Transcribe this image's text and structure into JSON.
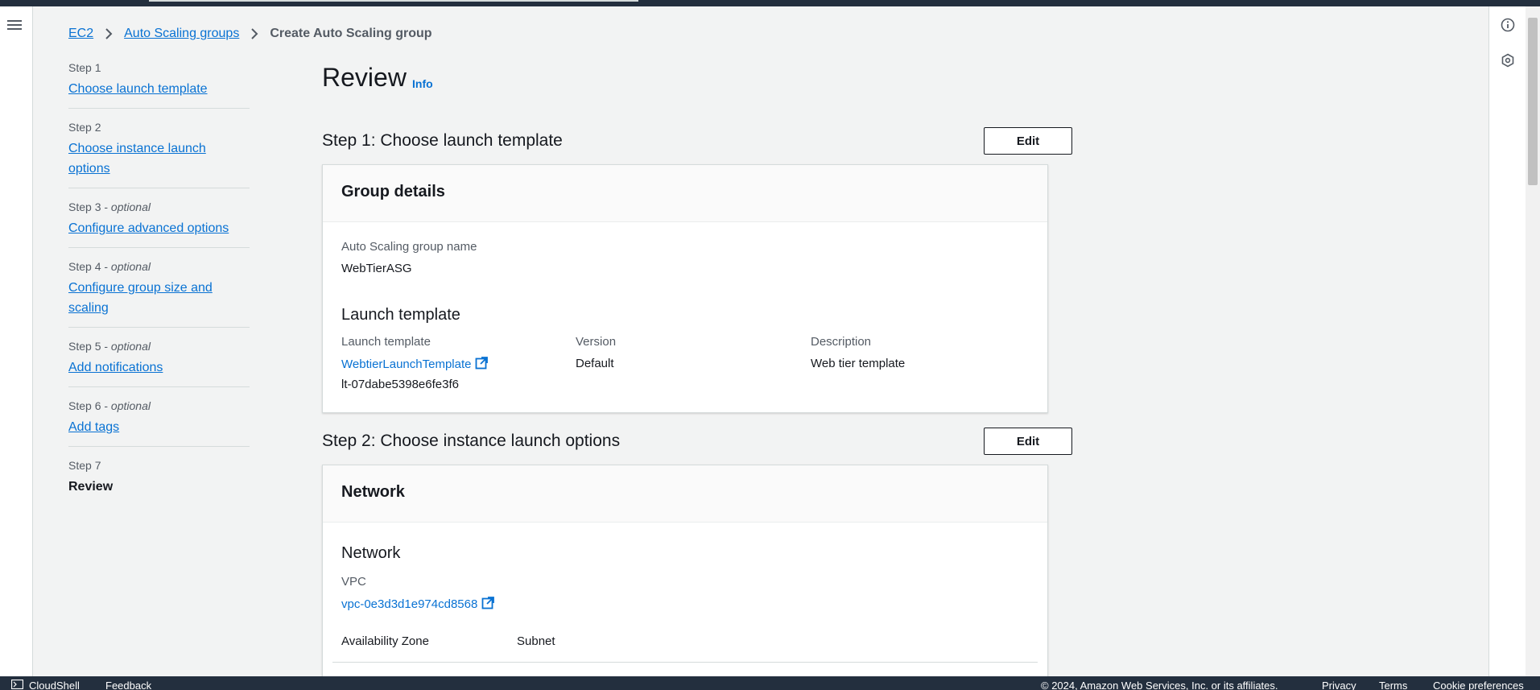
{
  "breadcrumb": {
    "ec2": "EC2",
    "asg": "Auto Scaling groups",
    "current": "Create Auto Scaling group"
  },
  "steps": [
    {
      "num": "Step 1",
      "optional": "",
      "label": "Choose launch template"
    },
    {
      "num": "Step 2",
      "optional": "",
      "label": "Choose instance launch options"
    },
    {
      "num": "Step 3 - ",
      "optional": "optional",
      "label": "Configure advanced options"
    },
    {
      "num": "Step 4 - ",
      "optional": "optional",
      "label": "Configure group size and scaling"
    },
    {
      "num": "Step 5 - ",
      "optional": "optional",
      "label": "Add notifications"
    },
    {
      "num": "Step 6 - ",
      "optional": "optional",
      "label": "Add tags"
    },
    {
      "num": "Step 7",
      "optional": "",
      "label": "Review"
    }
  ],
  "page": {
    "title": "Review",
    "info": "Info"
  },
  "section1": {
    "heading": "Step 1: Choose launch template",
    "edit": "Edit",
    "card_title": "Group details",
    "asg_name_label": "Auto Scaling group name",
    "asg_name_value": "WebTierASG",
    "lt_heading": "Launch template",
    "lt_label": "Launch template",
    "lt_link": "WebtierLaunchTemplate",
    "lt_id": "lt-07dabe5398e6fe3f6",
    "version_label": "Version",
    "version_value": "Default",
    "description_label": "Description",
    "description_value": "Web tier template"
  },
  "section2": {
    "heading": "Step 2: Choose instance launch options",
    "edit": "Edit",
    "card_title": "Network",
    "network_heading": "Network",
    "vpc_label": "VPC",
    "vpc_link": "vpc-0e3d3d1e974cd8568",
    "az_label": "Availability Zone",
    "subnet_label": "Subnet"
  },
  "footer": {
    "cloudshell": "CloudShell",
    "feedback": "Feedback",
    "copyright": "© 2024, Amazon Web Services, Inc. or its affiliates.",
    "privacy": "Privacy",
    "terms": "Terms",
    "cookies": "Cookie preferences"
  },
  "colors": {
    "link": "#0972d3",
    "nav_dark": "#232f3e"
  }
}
